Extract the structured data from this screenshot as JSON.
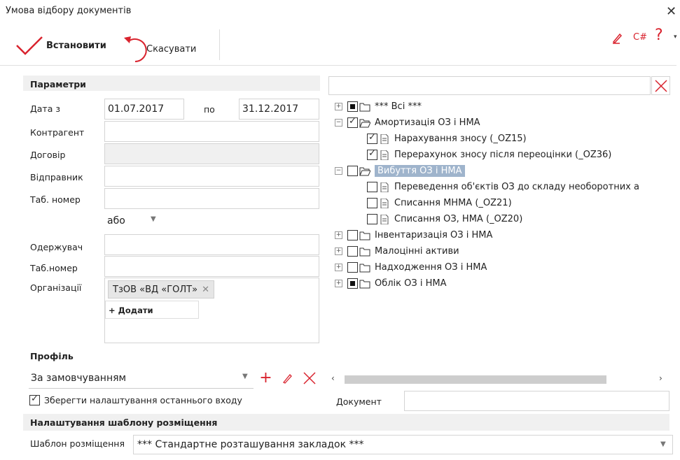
{
  "window": {
    "title": "Умова відбору документів"
  },
  "toolbar": {
    "apply_label": "Встановити",
    "cancel_label": "Скасувати",
    "right_icon_cs": "C#",
    "right_icon_help": "?"
  },
  "params": {
    "header": "Параметри",
    "date_from_label": "Дата з",
    "date_from": "01.07.2017",
    "date_to_label": "по",
    "date_to": "31.12.2017",
    "counterparty_label": "Контрагент",
    "contract_label": "Договір",
    "sender_label": "Відправник",
    "tab_no_label": "Таб. номер",
    "or_value": "або",
    "receiver_label": "Одержувач",
    "tab_no2_label": "Таб.номер",
    "orgs_label": "Організації",
    "org_tag": "ТзОВ «ВД «ГОЛТ»",
    "add_label": "+ Додати"
  },
  "profile": {
    "header": "Профіль",
    "value": "За замовчуванням",
    "save_last_label": "Зберегти налаштування останнього входу"
  },
  "layout_template": {
    "header": "Налаштування шаблону розміщення",
    "label": "Шаблон розміщення",
    "value": "*** Стандартне розташування закладок ***"
  },
  "tree": {
    "search_value": "",
    "items": [
      {
        "label": "*** Всі ***"
      },
      {
        "label": "Амортизація ОЗ і НМА"
      },
      {
        "label": "Нарахування зносу (_OZ15)"
      },
      {
        "label": "Перерахунок зносу після переоцінки (_OZ36)"
      },
      {
        "label": "Вибуття ОЗ і НМА"
      },
      {
        "label": "Переведення  об'єктів ОЗ до складу необоротних а"
      },
      {
        "label": "Списання МНМА (_OZ21)"
      },
      {
        "label": "Списання ОЗ, НМА (_OZ20)"
      },
      {
        "label": "Інвентаризація ОЗ і НМА"
      },
      {
        "label": "Малоцінні активи"
      },
      {
        "label": "Надходження ОЗ і НМА"
      },
      {
        "label": "Облік ОЗ і НМА"
      }
    ],
    "document_label": "Документ",
    "document_value": ""
  },
  "colors": {
    "accent_red": "#d9232e",
    "selection": "#9fb4cc",
    "header_tint": "#f0f0f0"
  }
}
